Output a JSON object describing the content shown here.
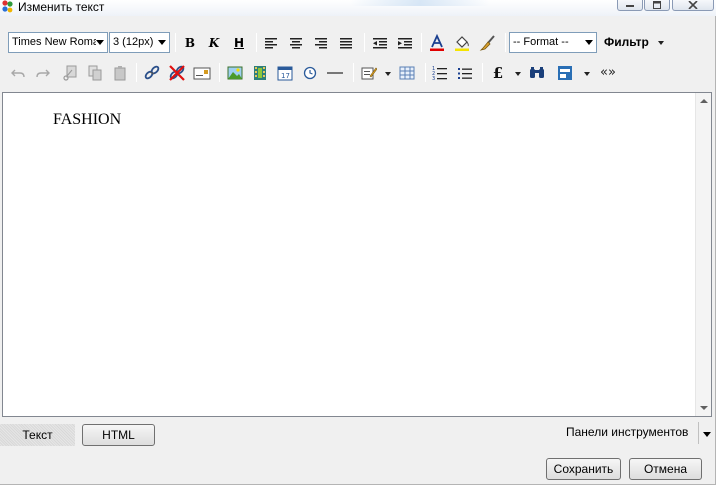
{
  "window": {
    "title": "Изменить текст"
  },
  "toolbar1": {
    "font_family": "Times New Roman",
    "font_size": "3 (12px)",
    "bold": "B",
    "italic": "K",
    "underline": "H",
    "format_select": "-- Format --",
    "filter_label": "Фильтр"
  },
  "toolbar2": {
    "pound_symbol": "£",
    "guillemets": "«»"
  },
  "editor": {
    "content": "FASHION"
  },
  "tabs": {
    "text_label": "Текст",
    "html_label": "HTML"
  },
  "panels": {
    "label": "Панели инструментов"
  },
  "buttons": {
    "save": "Сохранить",
    "cancel": "Отмена"
  },
  "colors": {
    "font_color_bar": "#e00000",
    "highlight_bar": "#f5e400"
  }
}
